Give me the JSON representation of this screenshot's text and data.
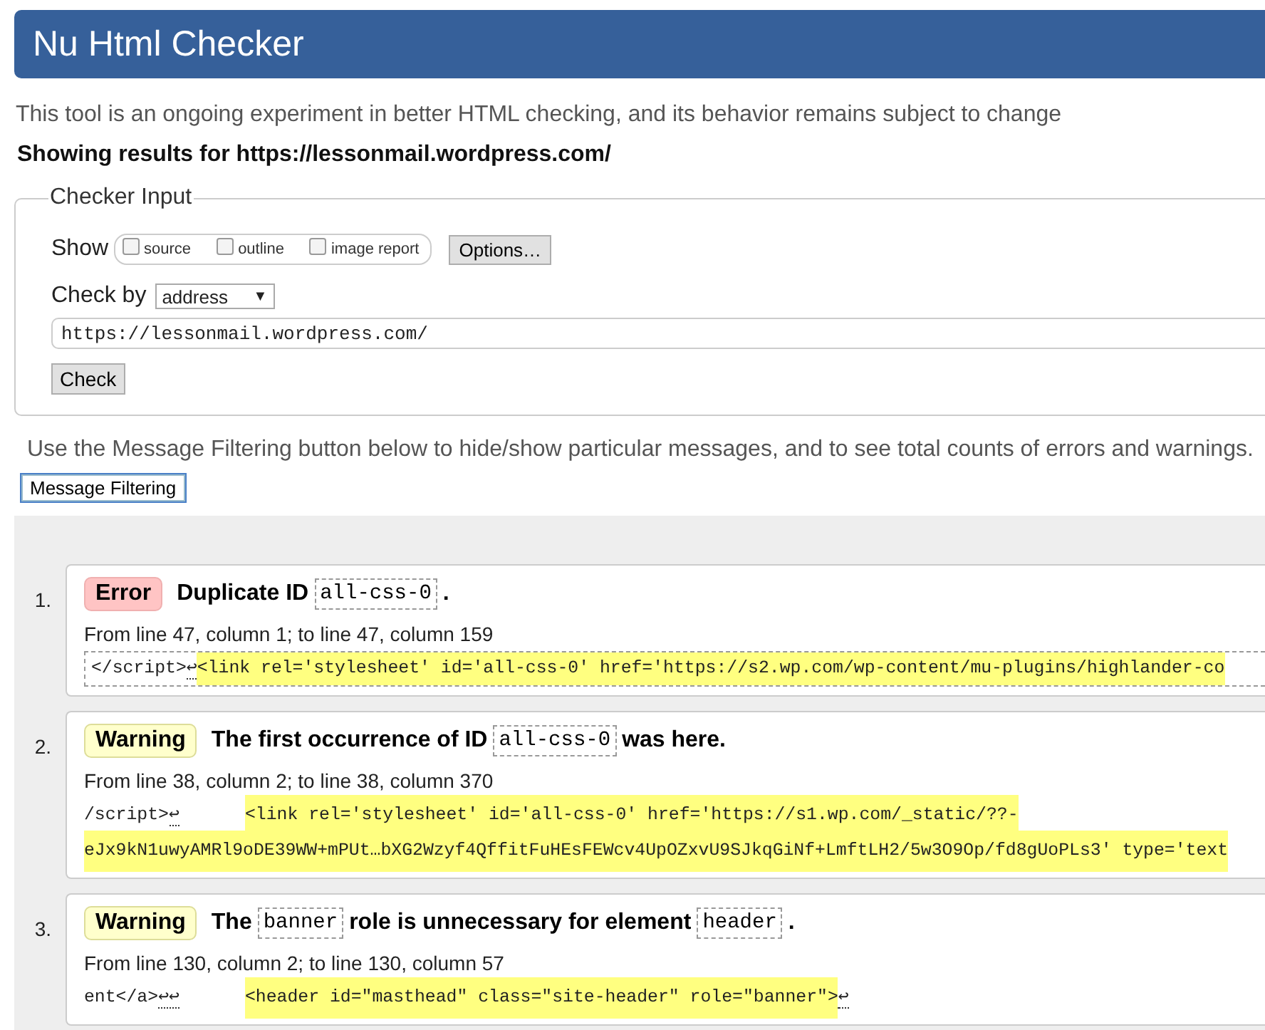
{
  "header": {
    "title": "Nu Html Checker"
  },
  "intro": "This tool is an ongoing experiment in better HTML checking, and its behavior remains subject to change",
  "results_for": "Showing results for https://lessonmail.wordpress.com/",
  "checker_input": {
    "legend": "Checker Input",
    "show_label": "Show",
    "show_options": [
      {
        "label": "source",
        "checked": false
      },
      {
        "label": "outline",
        "checked": false
      },
      {
        "label": "image report",
        "checked": false
      }
    ],
    "options_button": "Options…",
    "check_by_label": "Check by",
    "check_by_value": "address",
    "caret": "▼",
    "address_value": "https://lessonmail.wordpress.com/",
    "check_button": "Check"
  },
  "filter_hint": "Use the Message Filtering button below to hide/show particular messages, and to see total counts of errors and warnings.",
  "filter_button": "Message Filtering",
  "messages": [
    {
      "number": "1.",
      "kind": "error",
      "badge": "Error",
      "focused": true,
      "title": [
        {
          "kind": "text",
          "text": "Duplicate ID"
        },
        {
          "kind": "code",
          "text": "all-css-0"
        },
        {
          "kind": "text",
          "text": "."
        }
      ],
      "location": "From line 47, column 1; to line 47, column 159",
      "extract": [
        [
          {
            "kind": "text",
            "text": "</script>"
          },
          {
            "kind": "lf",
            "text": "↩",
            "tab": false
          },
          {
            "kind": "mark",
            "text": "<link rel='stylesheet' id='all-css-0' href='https://s2.wp.com/wp-content/mu-plugins/highlander-co"
          }
        ]
      ]
    },
    {
      "number": "2.",
      "kind": "warning",
      "badge": "Warning",
      "focused": false,
      "title": [
        {
          "kind": "text",
          "text": "The first occurrence of ID"
        },
        {
          "kind": "code",
          "text": "all-css-0"
        },
        {
          "kind": "text",
          "text": "was here."
        }
      ],
      "location": "From line 38, column 2; to line 38, column 370",
      "extract": [
        [
          {
            "kind": "text",
            "text": "/script>"
          },
          {
            "kind": "lf",
            "text": "↩",
            "tab": true
          },
          {
            "kind": "mark",
            "text": "<link rel='stylesheet' id='all-css-0' href='https://s1.wp.com/_static/??-"
          }
        ],
        [
          {
            "kind": "mark",
            "text": "eJx9kN1uwyAMRl9oDE39WW+mPUt…bXG2Wzyf4QffitFuHEsFEWcv4UpOZxvU9SJkqGiNf+LmftLH2/5w3O9Op/fd8gUoPLs3' type='text"
          }
        ]
      ]
    },
    {
      "number": "3.",
      "kind": "warning",
      "badge": "Warning",
      "focused": false,
      "title": [
        {
          "kind": "text",
          "text": "The"
        },
        {
          "kind": "code",
          "text": "banner"
        },
        {
          "kind": "text",
          "text": "role is unnecessary for element"
        },
        {
          "kind": "code",
          "text": "header"
        },
        {
          "kind": "text",
          "text": "."
        }
      ],
      "location": "From line 130, column 2; to line 130, column 57",
      "extract": [
        [
          {
            "kind": "text",
            "text": "ent</a>"
          },
          {
            "kind": "lf",
            "text": "↩↩",
            "tab": true
          },
          {
            "kind": "mark",
            "text": "<header id=\"masthead\" class=\"site-header\" role=\"banner\">"
          },
          {
            "kind": "lf",
            "text": "↩"
          }
        ]
      ]
    }
  ]
}
